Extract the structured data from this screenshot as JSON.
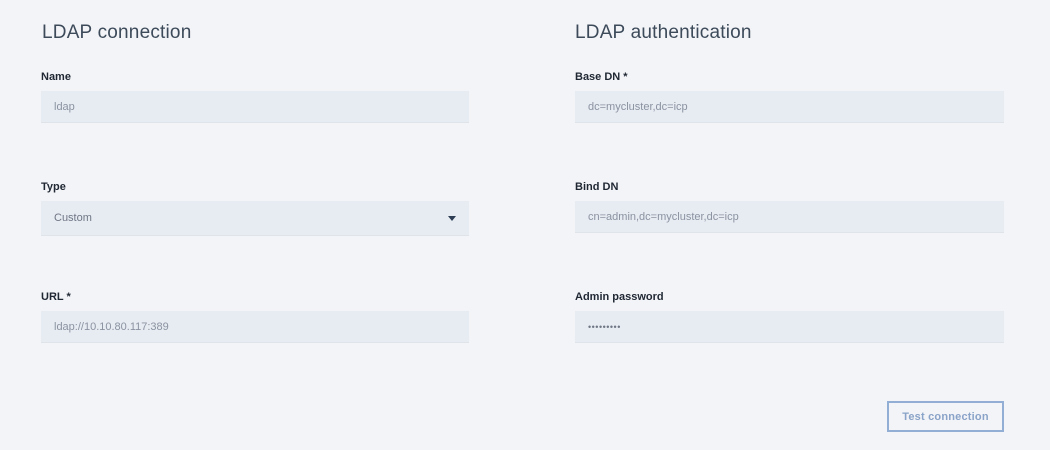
{
  "connection": {
    "title": "LDAP connection",
    "name": {
      "label": "Name",
      "value": "ldap"
    },
    "type": {
      "label": "Type",
      "value": "Custom"
    },
    "url": {
      "label": "URL *",
      "value": "ldap://10.10.80.117:389"
    }
  },
  "authentication": {
    "title": "LDAP authentication",
    "base_dn": {
      "label": "Base DN *",
      "value": "dc=mycluster,dc=icp"
    },
    "bind_dn": {
      "label": "Bind DN",
      "value": "cn=admin,dc=mycluster,dc=icp"
    },
    "admin_password": {
      "label": "Admin password",
      "masked_value": "•••••••••"
    }
  },
  "actions": {
    "test_connection_label": "Test connection"
  },
  "colors": {
    "background": "#f3f4f8",
    "input_background": "#e7ebf2",
    "button_border": "#93aed4"
  },
  "icons": {
    "type_dropdown": "caret-down-icon"
  }
}
